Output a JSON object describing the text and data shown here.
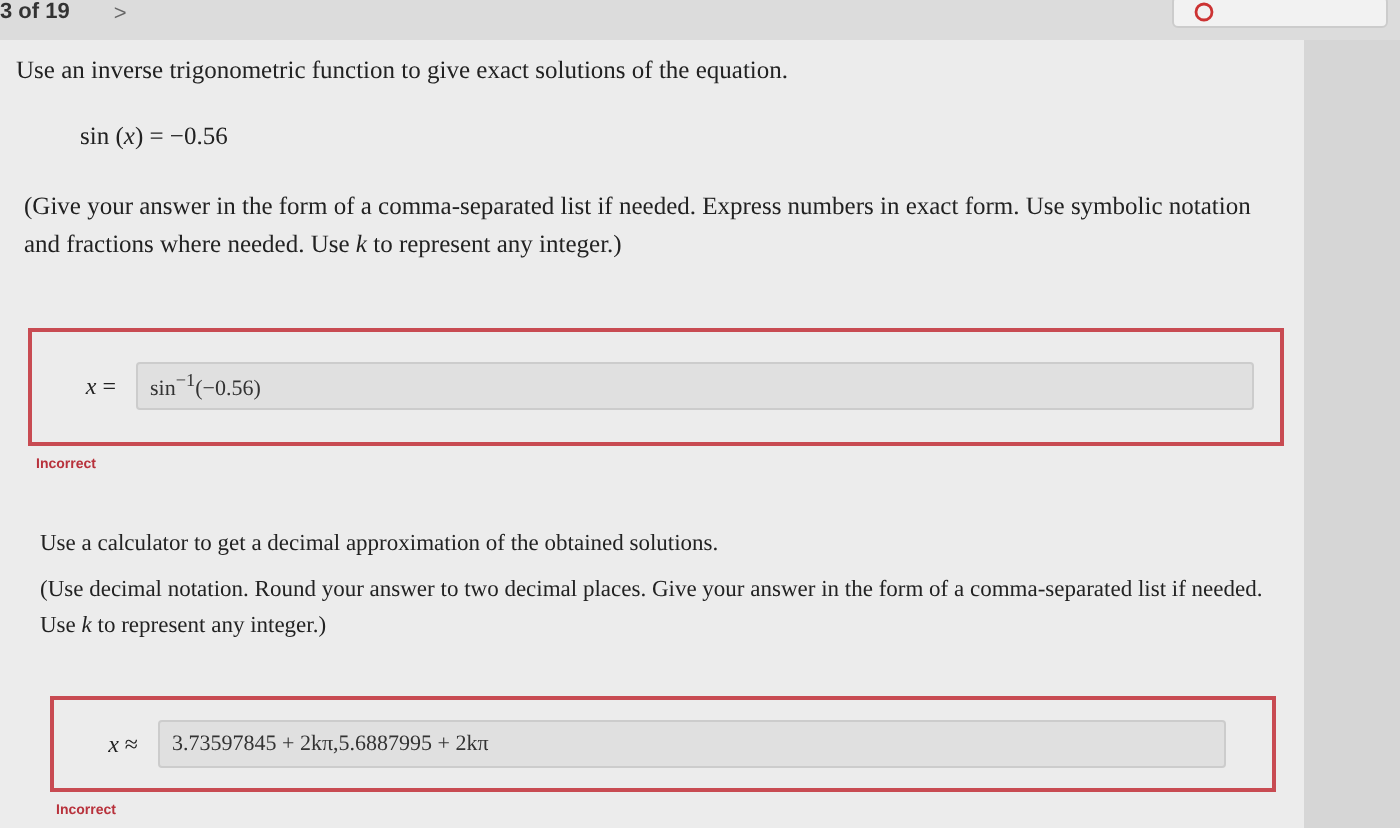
{
  "nav": {
    "position": "3 of 19",
    "next": ">"
  },
  "questions": [
    {
      "prompt": "Use an inverse trigonometric function to give exact solutions of the equation.",
      "equation": "sin (*x*) = −0.56",
      "instructions": "(Give your answer in the form of a comma-separated list if needed. Express numbers in exact form. Use symbolic notation and fractions where needed. Use *k* to represent any integer.)",
      "answer_label": "*x* =",
      "answer": "sin$^{−1}$(−0.56)",
      "correct": false,
      "status": "Incorrect"
    },
    {
      "prompt": "Use a calculator to get a decimal approximation of the obtained solutions.",
      "instructions": "(Use decimal notation. Round your answer to two decimal places. Give your answer in the form of a comma-separated list if needed. Use *k* to represent any integer.)",
      "answer_label": "*x* ≈",
      "answer": "3.73597845 + 2kπ,5.6887995 + 2kπ",
      "correct": false,
      "status": "Incorrect"
    }
  ]
}
